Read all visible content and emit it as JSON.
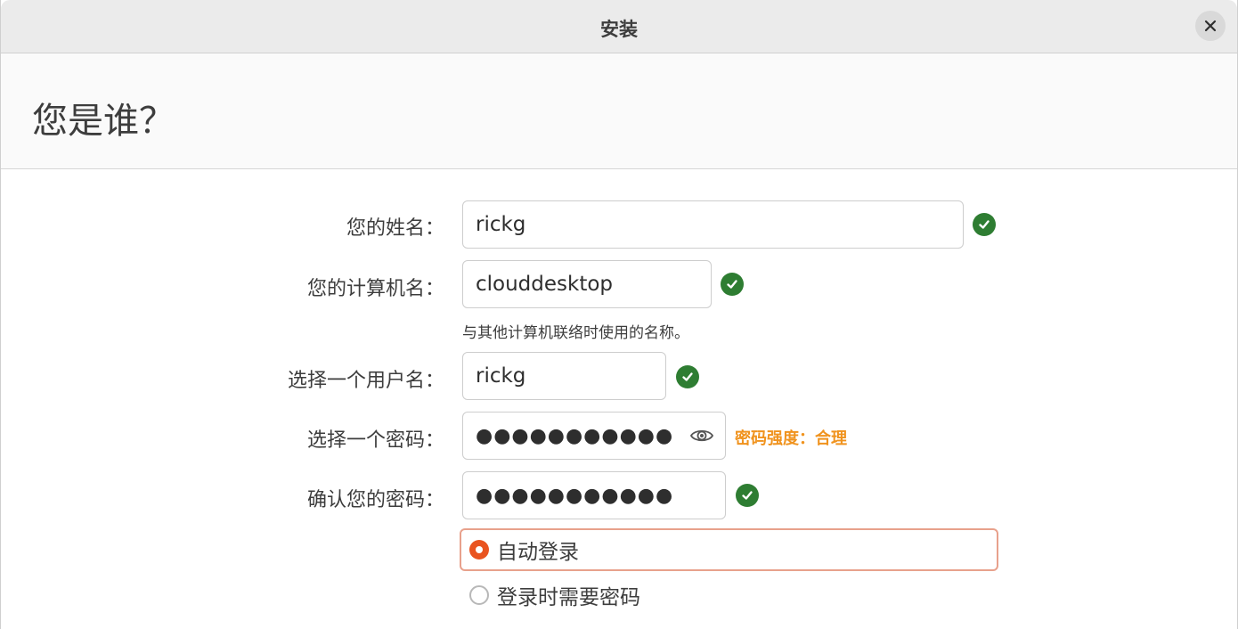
{
  "window": {
    "title": "安装"
  },
  "header": {
    "title": "您是谁？"
  },
  "form": {
    "name": {
      "label": "您的姓名：",
      "value": "rickg"
    },
    "computer": {
      "label": "您的计算机名：",
      "value": "clouddesktop",
      "hint": "与其他计算机联络时使用的名称。"
    },
    "username": {
      "label": "选择一个用户名：",
      "value": "rickg"
    },
    "password": {
      "label": "选择一个密码：",
      "value": "●●●●●●●●●●●",
      "strength": "密码强度：合理"
    },
    "confirm": {
      "label": "确认您的密码：",
      "value": "●●●●●●●●●●●"
    },
    "login_options": [
      {
        "label": "自动登录",
        "selected": true
      },
      {
        "label": "登录时需要密码",
        "selected": false
      }
    ]
  },
  "colors": {
    "accent": "#e95420",
    "ok": "#2e7d32",
    "strength": "#f0931e"
  },
  "icons": {
    "close": "close-icon",
    "ok": "checkmark-icon",
    "reveal": "eye-icon"
  }
}
